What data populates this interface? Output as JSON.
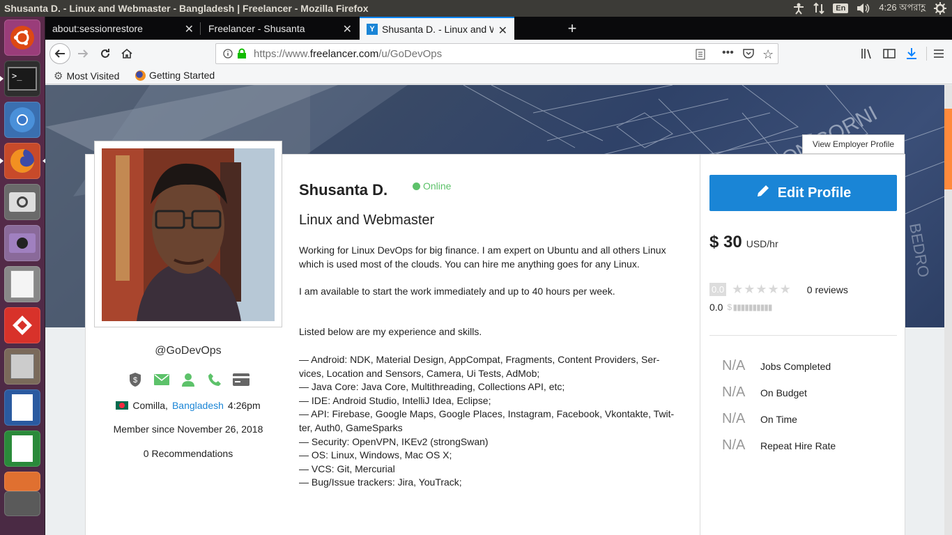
{
  "window_title": "Shusanta D. - Linux and Webmaster - Bangladesh | Freelancer - Mozilla Firefox",
  "system": {
    "language": "En",
    "clock": "4:26 অপরাহ্ণ"
  },
  "tabs": [
    {
      "label": "about:sessionrestore"
    },
    {
      "label": "Freelancer - Shusanta"
    },
    {
      "label": "Shusanta D. - Linux and W"
    }
  ],
  "url": {
    "prefix": "https://www.",
    "domain": "freelancer.com",
    "path": "/u/GoDevOps"
  },
  "bookmarks": [
    {
      "label": "Most Visited"
    },
    {
      "label": "Getting Started"
    }
  ],
  "profile": {
    "view_employer_label": "View Employer Profile",
    "handle": "@GoDevOps",
    "location_city": "Comilla,",
    "location_country": "Bangladesh",
    "local_time": "4:26pm",
    "member_since": "Member since November 26, 2018",
    "recommendations": "0 Recommendations",
    "name": "Shusanta D.",
    "status": "Online",
    "title": "Linux and Webmaster",
    "bio_1": "Working for Linux DevOps for big finance. I am expert on Ubuntu and all others Linux which is used most of the clouds. You can hire me anything goes for any Linux.",
    "bio_2": "I am available to start the work immediately and up to 40 hours per week.",
    "bio_3": "Listed below are my experience and skills.",
    "skills": [
      "— Android: NDK, Material Design, AppCompat, Fragments, Content Providers, Ser-vices, Location and Sensors, Camera, Ui Tests, AdMob;",
      "— Java Core: Java Core, Multithreading, Collections API, etc;",
      "— IDE: Android Studio, IntelliJ Idea, Eclipse;",
      "— API: Firebase, Google Maps, Google Places, Instagram, Facebook, Vkontakte, Twit-ter, Auth0, GameSparks",
      "— Security: OpenVPN, IKEv2 (strongSwan)",
      "— OS: Linux, Windows, Mac OS X;",
      "— VCS: Git, Mercurial",
      "— Bug/Issue trackers: Jira, YouTrack;"
    ],
    "edit_label": "Edit Profile",
    "rate_amount": "$ 30",
    "rate_unit": "USD/hr",
    "rating_badge": "0.0",
    "reviews": "0 reviews",
    "earnings_score": "0.0",
    "stats": [
      {
        "value": "N/A",
        "label": "Jobs Completed"
      },
      {
        "value": "N/A",
        "label": "On Budget"
      },
      {
        "value": "N/A",
        "label": "On Time"
      },
      {
        "value": "N/A",
        "label": "Repeat Hire Rate"
      }
    ]
  },
  "colors": {
    "accent": "#1a85d6",
    "online": "#5dc26a",
    "tab_highlight": "#0a84ff",
    "scroll": "#ff8a3c"
  }
}
